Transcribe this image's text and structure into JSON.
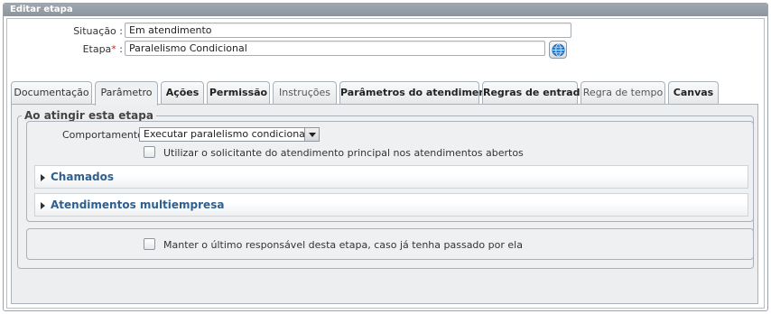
{
  "window": {
    "title": "Editar etapa"
  },
  "form": {
    "situacao": {
      "label": "Situação :",
      "value": "Em atendimento"
    },
    "etapa": {
      "label": "Etapa",
      "required_mark": "*",
      "suffix": " :",
      "value": "Paralelismo Condicional"
    },
    "lookup_icon": "globe-icon"
  },
  "tabs": [
    {
      "label": "Documentação",
      "state": "normal"
    },
    {
      "label": "Parâmetro",
      "state": "active"
    },
    {
      "label": "Ações",
      "state": "bold"
    },
    {
      "label": "Permissão",
      "state": "bold"
    },
    {
      "label": "Instruções",
      "state": "muted"
    },
    {
      "label": "Parâmetros do atendimento",
      "state": "bold"
    },
    {
      "label": "Regras de entrada",
      "state": "bold"
    },
    {
      "label": "Regra de tempo",
      "state": "muted"
    },
    {
      "label": "Canvas",
      "state": "bold"
    }
  ],
  "panel": {
    "legend": "Ao atingir esta etapa",
    "comportamento": {
      "label": "Comportamento :",
      "value": "Executar paralelismo condicional"
    },
    "checkbox_solicitante": {
      "label": "Utilizar o solicitante do atendimento principal nos atendimentos abertos",
      "checked": false
    },
    "sections": [
      {
        "label": "Chamados"
      },
      {
        "label": "Atendimentos multiempresa"
      }
    ],
    "checkbox_responsavel": {
      "label": "Manter o último responsável desta etapa, caso já tenha passado por ela",
      "checked": false
    }
  },
  "colors": {
    "section_title": "#2e5f8f",
    "required": "#d32222",
    "titlebar": "#949da6"
  }
}
